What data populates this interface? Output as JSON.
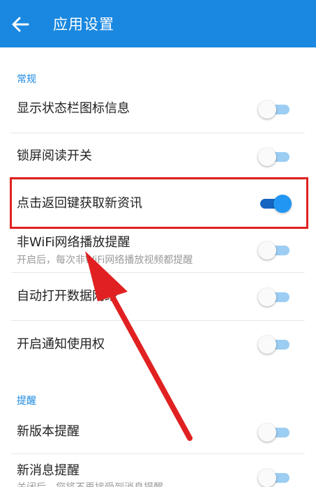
{
  "appbar": {
    "title": "应用设置",
    "color": "#1a88e0"
  },
  "sections": {
    "general": "常规",
    "reminder": "提醒"
  },
  "settings": [
    {
      "title": "显示状态栏图标信息",
      "subtitle": "",
      "enabled": false
    },
    {
      "title": "锁屏阅读开关",
      "subtitle": "",
      "enabled": false
    },
    {
      "title": "点击返回键获取新资讯",
      "subtitle": "",
      "enabled": true
    },
    {
      "title": "非WiFi网络播放提醒",
      "subtitle": "开启后，每次非WiFi网络播放视频都提醒",
      "enabled": false
    },
    {
      "title": "自动打开数据网络",
      "subtitle": "",
      "enabled": false
    },
    {
      "title": "开启通知使用权",
      "subtitle": "",
      "enabled": false
    },
    {
      "title": "新版本提醒",
      "subtitle": "",
      "enabled": false
    },
    {
      "title": "新消息提醒",
      "subtitle": "关闭后，您将不再接受到消息提醒",
      "enabled": false
    }
  ],
  "annotation": {
    "highlight_color": "#e12121",
    "icons": [
      "back-arrow-icon",
      "red-pointer-arrow"
    ]
  }
}
